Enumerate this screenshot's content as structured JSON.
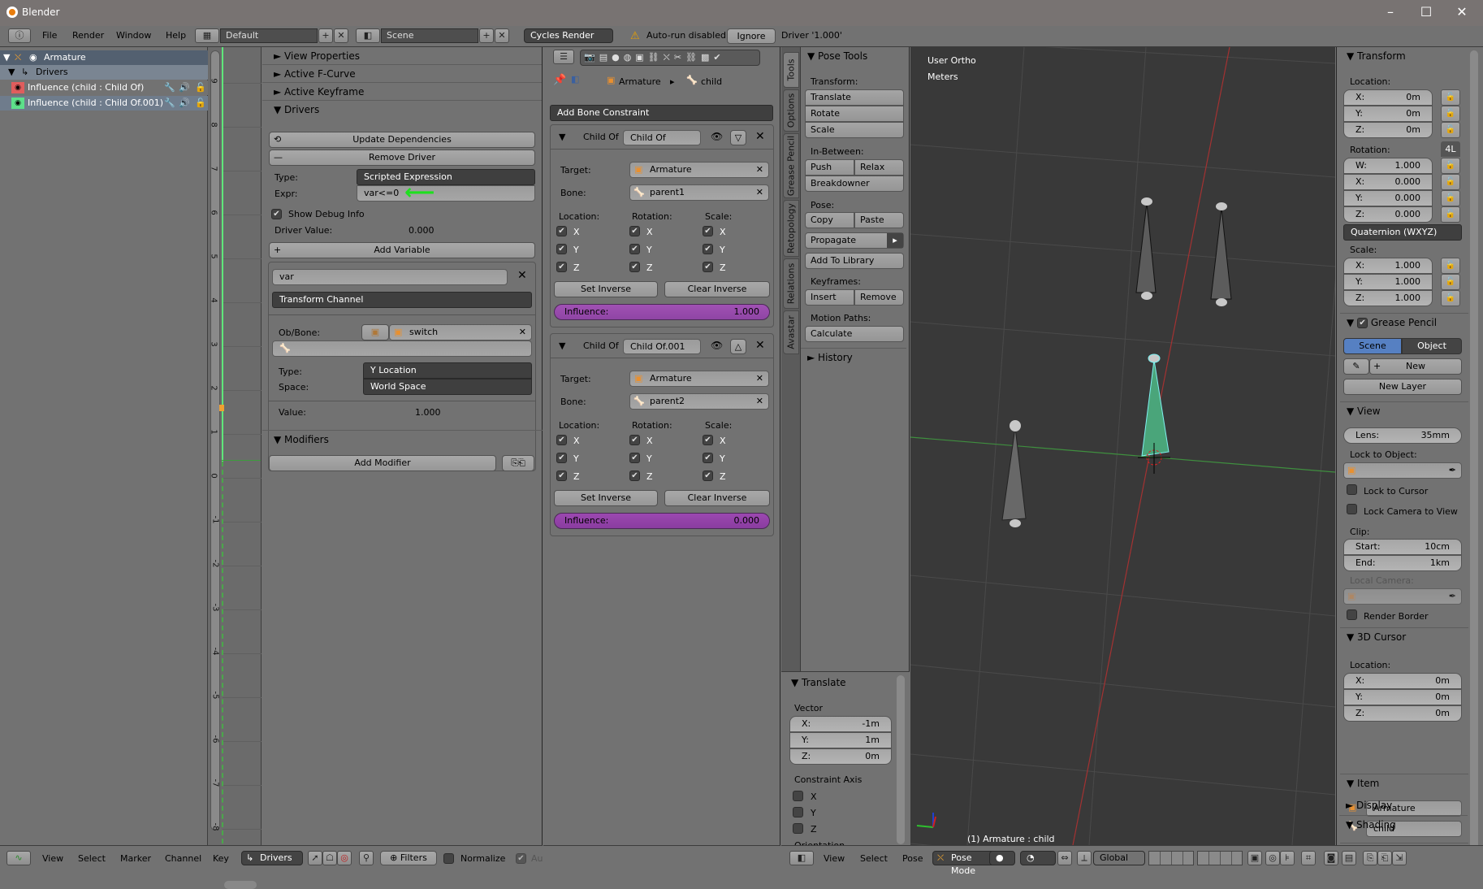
{
  "window": {
    "title": "Blender",
    "minimize": "–",
    "maximize": "☐",
    "close": "✕"
  },
  "topbar": {
    "menus": [
      "File",
      "Render",
      "Window",
      "Help"
    ],
    "layout": "Default",
    "scene": "Scene",
    "render_engine": "Cycles Render",
    "warning": "Auto-run disabled",
    "ignore_button": "Ignore",
    "status": "Driver '1.000'"
  },
  "channels": {
    "rows": [
      {
        "label": "Armature",
        "type": "object"
      },
      {
        "label": "Drivers",
        "type": "group"
      },
      {
        "label": "Influence (child : Child Of)",
        "color": "#e05d5d"
      },
      {
        "label": "Influence (child : Child Of.001)",
        "color": "#5de08a"
      }
    ]
  },
  "graph": {
    "ticks": [
      "9",
      "8",
      "7",
      "6",
      "5",
      "4",
      "3",
      "2",
      "1",
      "0",
      "-1",
      "-2",
      "-3",
      "-4",
      "-5",
      "-6",
      "-7",
      "-8"
    ]
  },
  "drivers_panel": {
    "sections": {
      "view_properties": "View Properties",
      "active_fcurve": "Active F-Curve",
      "active_keyframe": "Active Keyframe",
      "drivers": "Drivers",
      "modifiers": "Modifiers"
    },
    "update_dependencies": "Update Dependencies",
    "remove_driver": "Remove Driver",
    "type_label": "Type:",
    "type_value": "Scripted Expression",
    "expr_label": "Expr:",
    "expr_value": "var<=0",
    "show_debug": "Show Debug Info",
    "driver_value_label": "Driver Value:",
    "driver_value": "0.000",
    "add_variable": "Add Variable",
    "variable": {
      "name": "var",
      "var_type": "Transform Channel",
      "ob_bone_label": "Ob/Bone:",
      "object": "switch",
      "bone": "",
      "type_label": "Type:",
      "type_value": "Y Location",
      "space_label": "Space:",
      "space_value": "World Space",
      "value_label": "Value:",
      "value": "1.000"
    },
    "add_modifier": "Add Modifier"
  },
  "properties": {
    "breadcrumb": {
      "object": "Armature",
      "bone": "child"
    },
    "add_constraint": "Add Bone Constraint",
    "constraints": [
      {
        "type": "Child Of",
        "name": "Child Of",
        "target_label": "Target:",
        "target": "Armature",
        "bone_label": "Bone:",
        "bone": "parent1",
        "influence_label": "Influence:",
        "influence": "1.000",
        "influence_value": 1.0
      },
      {
        "type": "Child Of",
        "name": "Child Of.001",
        "target_label": "Target:",
        "target": "Armature",
        "bone_label": "Bone:",
        "bone": "parent2",
        "influence_label": "Influence:",
        "influence": "0.000",
        "influence_value": 0.0
      }
    ],
    "location_label": "Location:",
    "rotation_label": "Rotation:",
    "scale_label": "Scale:",
    "axes": [
      "X",
      "Y",
      "Z"
    ],
    "set_inverse": "Set Inverse",
    "clear_inverse": "Clear Inverse"
  },
  "tool_tabs": [
    "Tools",
    "Options",
    "Grease Pencil",
    "Retopology",
    "Relations",
    "Avastar"
  ],
  "pose_tools": {
    "title": "Pose Tools",
    "transform_label": "Transform:",
    "translate": "Translate",
    "rotate": "Rotate",
    "scale": "Scale",
    "inbetween_label": "In-Between:",
    "push": "Push",
    "relax": "Relax",
    "breakdowner": "Breakdowner",
    "pose_label": "Pose:",
    "copy": "Copy",
    "paste": "Paste",
    "propagate": "Propagate",
    "add_to_library": "Add To Library",
    "keyframes_label": "Keyframes:",
    "insert": "Insert",
    "remove": "Remove",
    "motion_paths_label": "Motion Paths:",
    "calculate": "Calculate",
    "history": "History"
  },
  "translate_op": {
    "title": "Translate",
    "vector_label": "Vector",
    "x_label": "X:",
    "x": "-1m",
    "y_label": "Y:",
    "y": "1m",
    "z_label": "Z:",
    "z": "0m",
    "constraint_axis_label": "Constraint Axis",
    "axes": [
      "X",
      "Y",
      "Z"
    ],
    "orientation_label": "Orientation"
  },
  "viewport": {
    "view_name": "User Ortho",
    "units": "Meters",
    "status": "(1) Armature : child"
  },
  "npanel": {
    "transform_title": "Transform",
    "location_label": "Location:",
    "location": [
      {
        "axis": "X:",
        "value": "0m"
      },
      {
        "axis": "Y:",
        "value": "0m"
      },
      {
        "axis": "Z:",
        "value": "0m"
      }
    ],
    "rotation_label": "Rotation:",
    "rot_mode_button": "4L",
    "rotation": [
      {
        "axis": "W:",
        "value": "1.000"
      },
      {
        "axis": "X:",
        "value": "0.000"
      },
      {
        "axis": "Y:",
        "value": "0.000"
      },
      {
        "axis": "Z:",
        "value": "0.000"
      }
    ],
    "rotation_mode": "Quaternion (WXYZ)",
    "scale_label": "Scale:",
    "scale": [
      {
        "axis": "X:",
        "value": "1.000"
      },
      {
        "axis": "Y:",
        "value": "1.000"
      },
      {
        "axis": "Z:",
        "value": "1.000"
      }
    ],
    "grease_pencil_title": "Grease Pencil",
    "gp_scene": "Scene",
    "gp_object": "Object",
    "gp_new": "New",
    "gp_new_layer": "New Layer",
    "view_title": "View",
    "lens_label": "Lens:",
    "lens": "35mm",
    "lock_to_object_label": "Lock to Object:",
    "lock_to_cursor": "Lock to Cursor",
    "lock_camera": "Lock Camera to View",
    "clip_label": "Clip:",
    "clip_start_label": "Start:",
    "clip_start": "10cm",
    "clip_end_label": "End:",
    "clip_end": "1km",
    "local_camera_label": "Local Camera:",
    "render_border": "Render Border",
    "cursor_title": "3D Cursor",
    "cursor_location_label": "Location:",
    "cursor": [
      {
        "axis": "X:",
        "value": "0m"
      },
      {
        "axis": "Y:",
        "value": "0m"
      },
      {
        "axis": "Z:",
        "value": "0m"
      }
    ],
    "item_title": "Item",
    "item_object": "Armature",
    "item_bone": "child",
    "display_title": "Display",
    "shading_title": "Shading"
  },
  "graph_footer": {
    "menus": [
      "View",
      "Select",
      "Marker",
      "Channel",
      "Key"
    ],
    "mode": "Drivers",
    "filters": "Filters",
    "normalize": "Normalize",
    "auto": "Au"
  },
  "view3d_footer": {
    "menus": [
      "View",
      "Select",
      "Pose"
    ],
    "mode": "Pose Mode",
    "orientation": "Global"
  }
}
